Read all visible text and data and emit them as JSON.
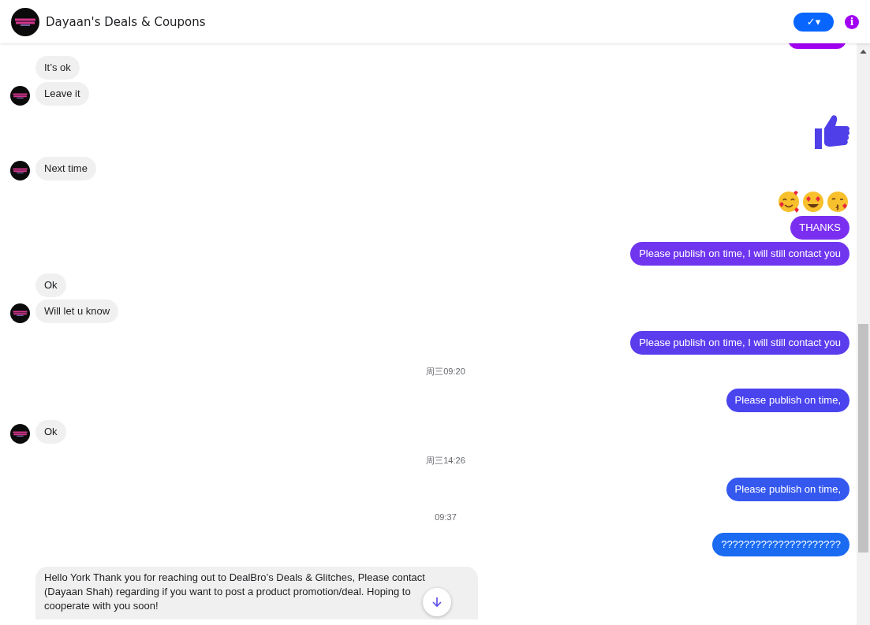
{
  "header": {
    "title": "Dayaan's Deals & Coupons",
    "status_button": "✓▾",
    "info_button": "i"
  },
  "messages": [
    {
      "kind": "outgoing_partial",
      "color": "#a100f2"
    },
    {
      "kind": "incoming",
      "text": "It’s ok",
      "avatar": false
    },
    {
      "kind": "incoming",
      "text": "Leave it",
      "avatar": true
    },
    {
      "kind": "like",
      "color": "#4f3fe8"
    },
    {
      "kind": "incoming",
      "text": "Next time",
      "avatar": true
    },
    {
      "kind": "emoji"
    },
    {
      "kind": "outgoing",
      "text": "THANKS",
      "color": "#7a2ff0"
    },
    {
      "kind": "outgoing",
      "text": "Please publish on time, I will still contact you",
      "color": "#6f35ef"
    },
    {
      "kind": "incoming",
      "text": "Ok",
      "avatar": false
    },
    {
      "kind": "incoming",
      "text": "Will let u know",
      "avatar": true
    },
    {
      "kind": "outgoing",
      "text": "Please publish on time, I will still contact you",
      "color": "#5b3dee"
    },
    {
      "kind": "timestamp",
      "text": "周三09:20"
    },
    {
      "kind": "outgoing",
      "text": "Please publish on time,",
      "color": "#4a44ee"
    },
    {
      "kind": "incoming",
      "text": "Ok",
      "avatar": true
    },
    {
      "kind": "timestamp",
      "text": "周三14:26"
    },
    {
      "kind": "outgoing",
      "text": "Please publish on time,",
      "color": "#3558ef"
    },
    {
      "kind": "timestamp",
      "text": "09:37"
    },
    {
      "kind": "outgoing",
      "text": "?????????????????????",
      "color": "#1a6bf2"
    },
    {
      "kind": "incoming",
      "text": "Hello York Thank you for reaching out to DealBro’s Deals & Glitches, Please contact (Dayaan Shah) regarding if you want to post a product promotion/deal. Hoping to cooperate with you soon!",
      "avatar": false
    }
  ]
}
